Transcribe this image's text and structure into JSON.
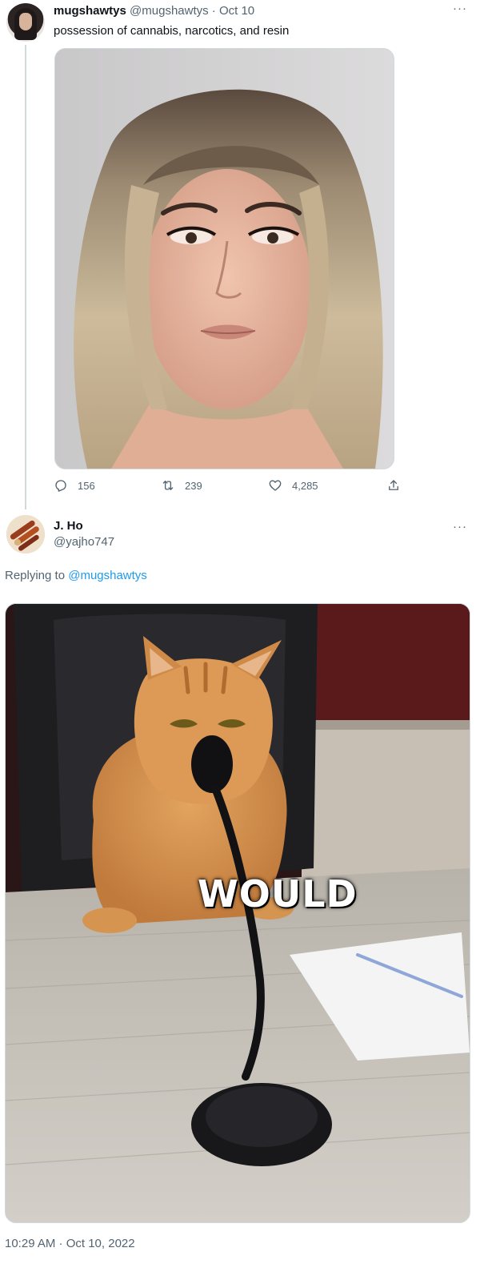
{
  "tweet": {
    "display_name": "mugshawtys",
    "handle_date": "@mugshawtys · Oct 10",
    "text": "possession of cannabis, narcotics, and resin",
    "more_label": "···",
    "stats": {
      "replies": "156",
      "retweets": "239",
      "likes": "4,285"
    }
  },
  "reply": {
    "display_name": "J. Ho",
    "handle": "@yajho747",
    "more_label": "···",
    "replying_prefix": "Replying to",
    "replying_to": "@mugshawtys",
    "image_caption": "WOULD",
    "timestamp": "10:29 AM · Oct 10, 2022"
  },
  "colors": {
    "text": "#0f1419",
    "secondary": "#536471",
    "link": "#1d9bf0",
    "border": "#cfd9de"
  }
}
